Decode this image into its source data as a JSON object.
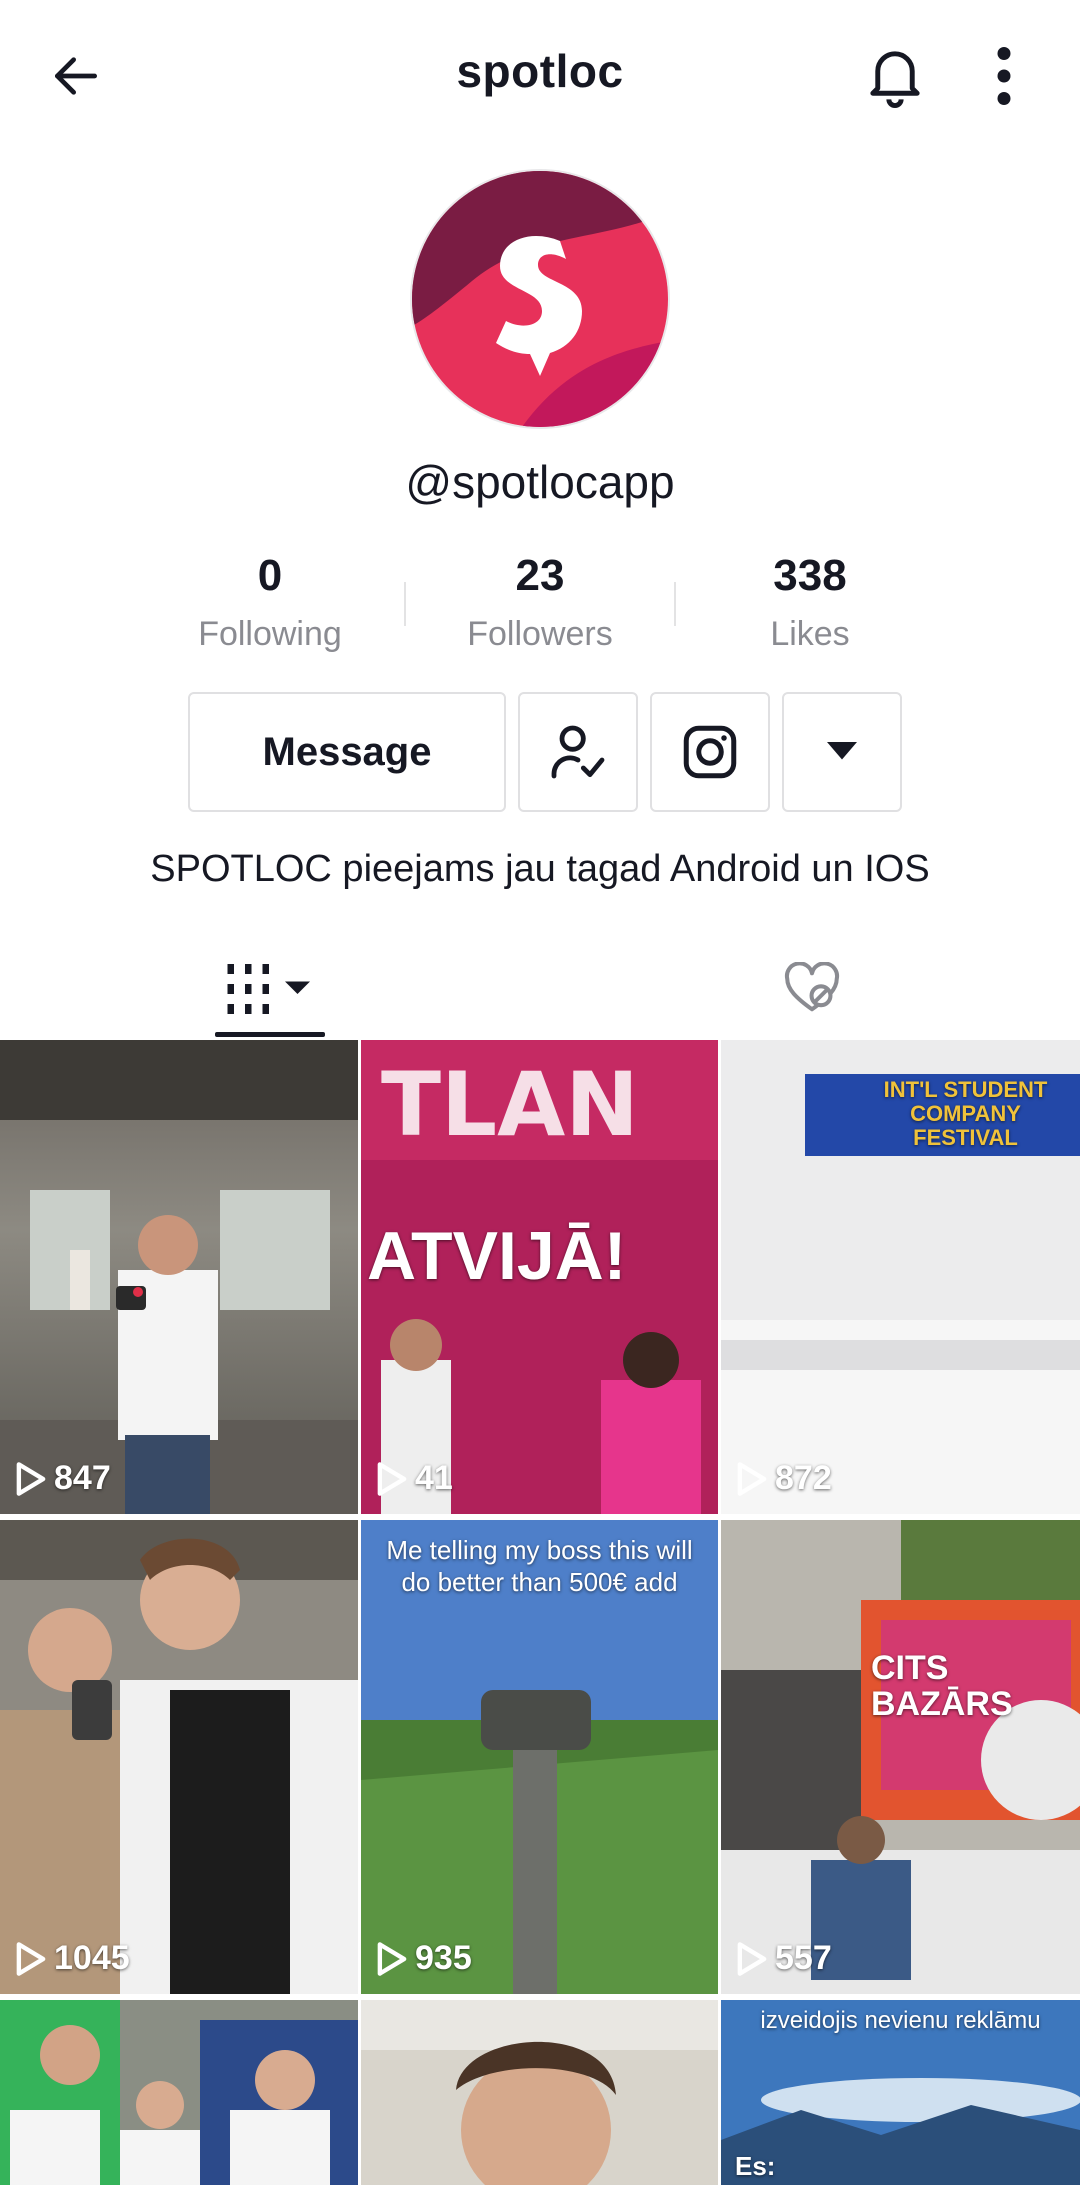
{
  "header": {
    "title": "spotloc",
    "back_icon": "arrow-left-icon",
    "bell_icon": "bell-icon",
    "more_icon": "more-vertical-icon"
  },
  "profile": {
    "username": "@spotlocapp",
    "avatar_letter": "S",
    "brand_colors": {
      "primary": "#E7315A",
      "dark": "#C2185B",
      "maroon": "#7A1C43"
    },
    "bio": "SPOTLOC pieejams jau tagad Android un IOS"
  },
  "stats": [
    {
      "value": "0",
      "label": "Following"
    },
    {
      "value": "23",
      "label": "Followers"
    },
    {
      "value": "338",
      "label": "Likes"
    }
  ],
  "actions": {
    "message_label": "Message",
    "friends_icon": "user-check-icon",
    "instagram_icon": "instagram-icon",
    "dropdown_icon": "caret-down-icon"
  },
  "tabs": {
    "videos_icon": "video-grid-icon",
    "liked_icon": "heart-hidden-icon"
  },
  "videos": [
    {
      "views": "847",
      "caption": ""
    },
    {
      "views": "41",
      "caption": "ATVIJĀ!"
    },
    {
      "views": "872",
      "caption": "INT'L STUDENT COMPANY FESTIVAL"
    },
    {
      "views": "1045",
      "caption": ""
    },
    {
      "views": "935",
      "caption": "Me telling my boss this will do better than 500€ add"
    },
    {
      "views": "557",
      "caption": "CITS BAZĀRS"
    },
    {
      "views": "",
      "caption": ""
    },
    {
      "views": "",
      "caption": ""
    },
    {
      "views": "",
      "caption": "izveidojis nevienu reklāmu",
      "caption2": "Es:"
    }
  ]
}
